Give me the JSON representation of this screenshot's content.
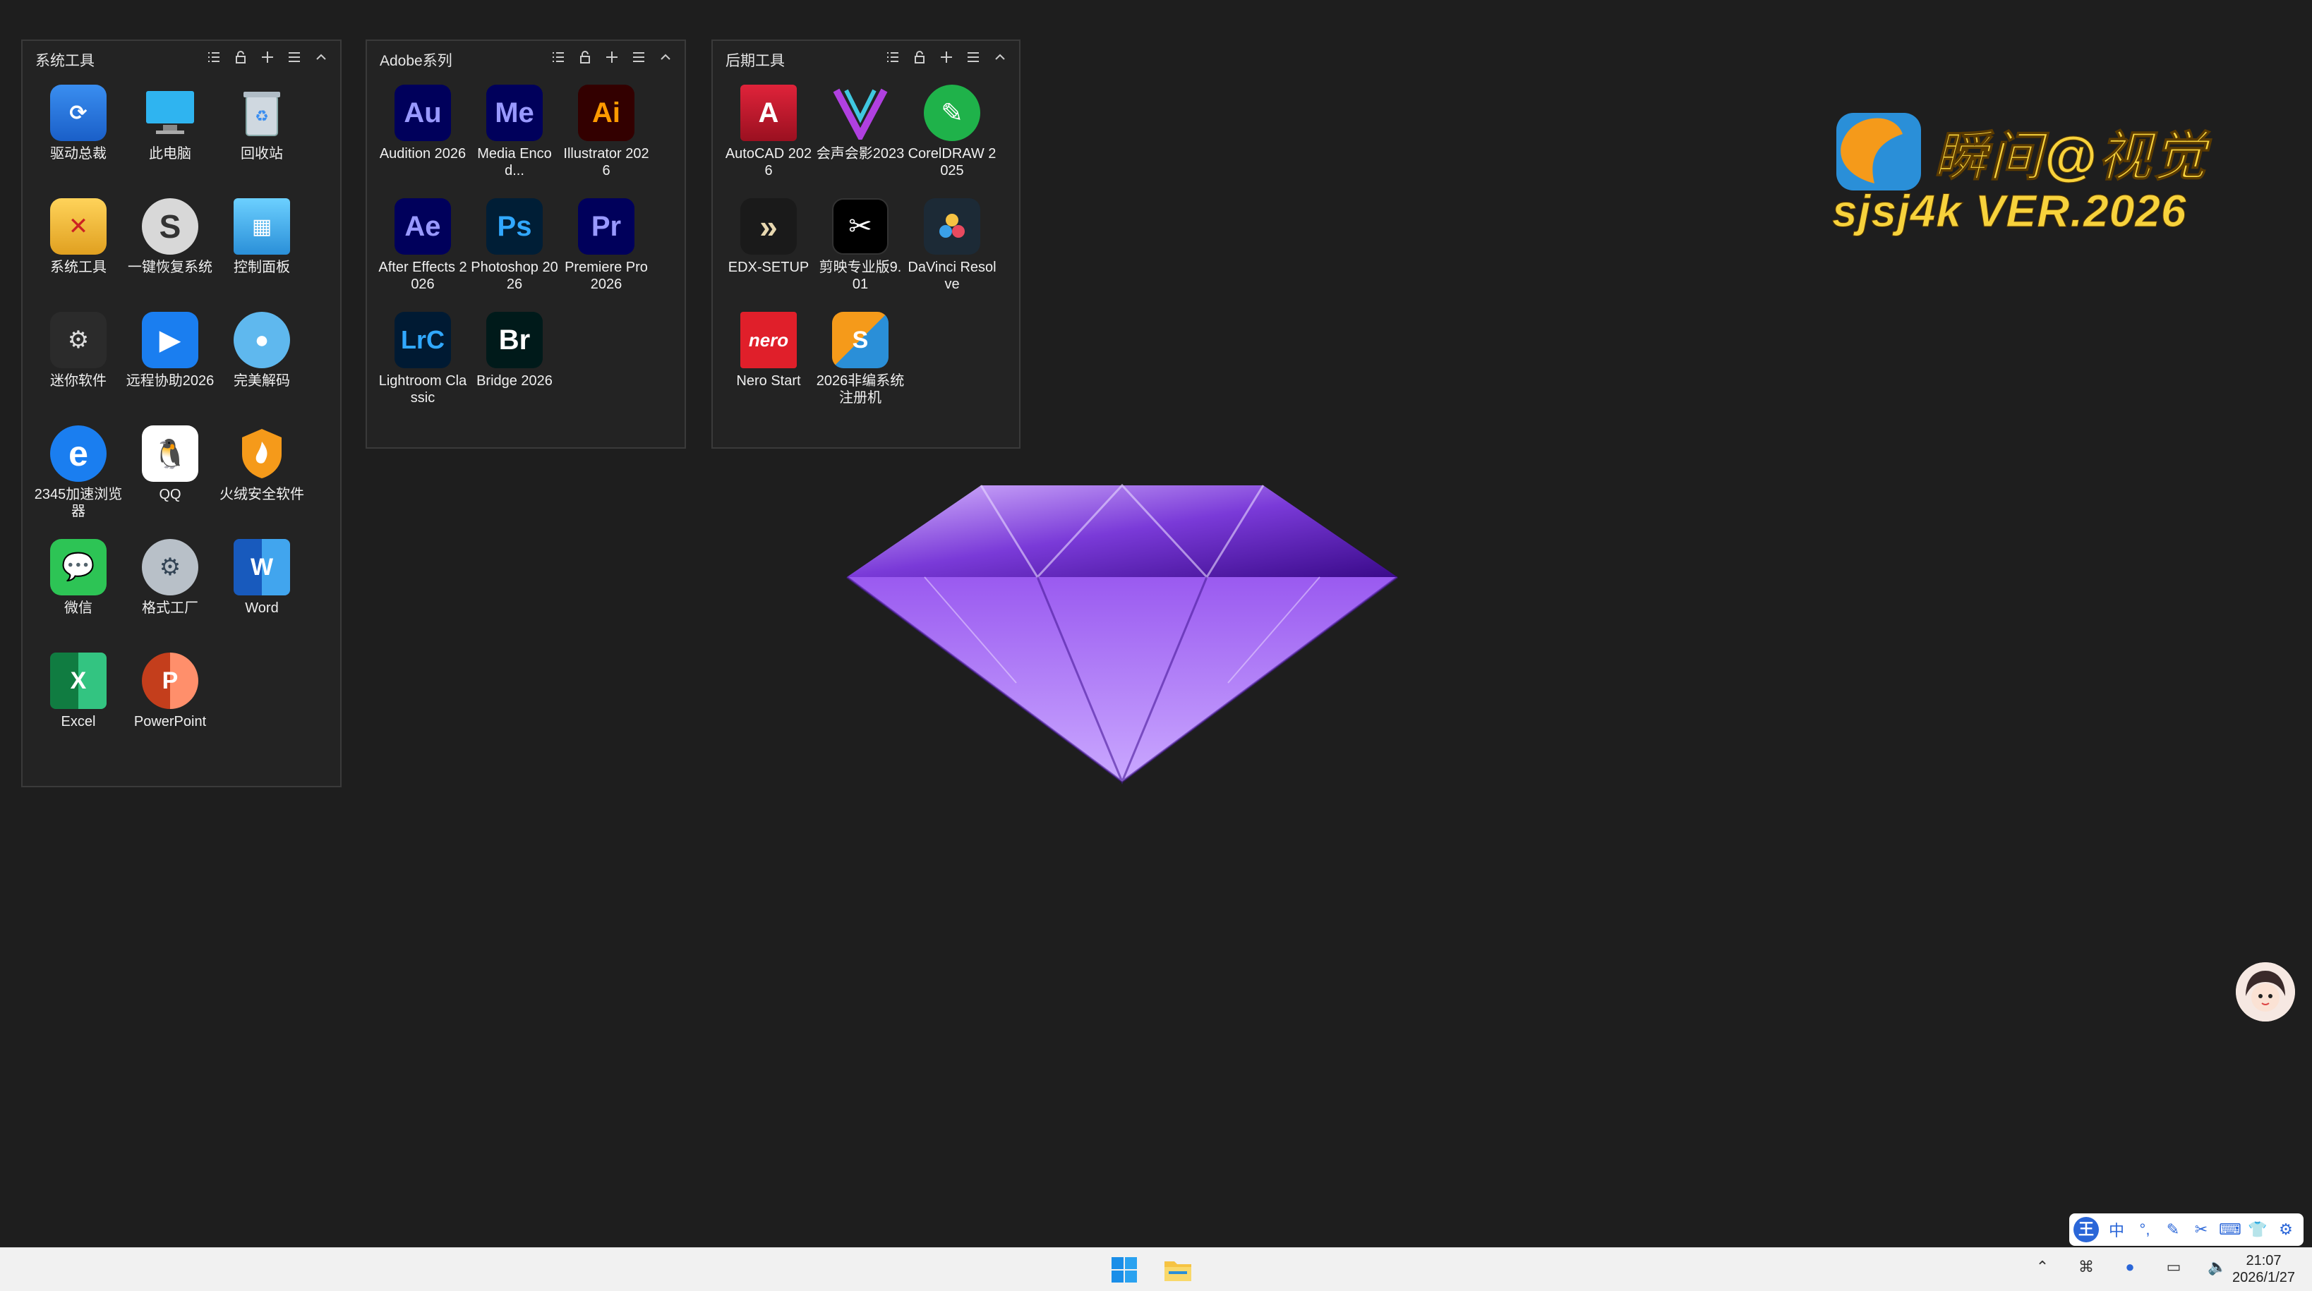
{
  "panels": [
    {
      "title": "系统工具",
      "apps": [
        {
          "label": "驱动总裁",
          "icon": "driver-tool-icon"
        },
        {
          "label": "此电脑",
          "icon": "computer-icon"
        },
        {
          "label": "回收站",
          "icon": "recycle-bin-icon"
        },
        {
          "label": "系统工具",
          "icon": "system-tools-icon"
        },
        {
          "label": "一键恢复系统",
          "icon": "system-restore-icon"
        },
        {
          "label": "控制面板",
          "icon": "control-panel-icon"
        },
        {
          "label": "迷你软件",
          "icon": "mini-software-icon"
        },
        {
          "label": "远程协助2026",
          "icon": "remote-assist-icon"
        },
        {
          "label": "完美解码",
          "icon": "potplayer-icon"
        },
        {
          "label": "2345加速浏览器",
          "icon": "browser-2345-icon"
        },
        {
          "label": "QQ",
          "icon": "qq-icon"
        },
        {
          "label": "火绒安全软件",
          "icon": "huorong-icon"
        },
        {
          "label": "微信",
          "icon": "wechat-icon"
        },
        {
          "label": "格式工厂",
          "icon": "format-factory-icon"
        },
        {
          "label": "Word",
          "icon": "word-icon"
        },
        {
          "label": "Excel",
          "icon": "excel-icon"
        },
        {
          "label": "PowerPoint",
          "icon": "powerpoint-icon"
        }
      ]
    },
    {
      "title": "Adobe系列",
      "apps": [
        {
          "label": "Audition 2026",
          "icon": "audition-icon",
          "abbr": "Au"
        },
        {
          "label": "Media Encod...",
          "icon": "media-encoder-icon",
          "abbr": "Me"
        },
        {
          "label": "Illustrator 2026",
          "icon": "illustrator-icon",
          "abbr": "Ai"
        },
        {
          "label": "After Effects 2026",
          "icon": "after-effects-icon",
          "abbr": "Ae"
        },
        {
          "label": "Photoshop 2026",
          "icon": "photoshop-icon",
          "abbr": "Ps"
        },
        {
          "label": "Premiere Pro 2026",
          "icon": "premiere-icon",
          "abbr": "Pr"
        },
        {
          "label": "Lightroom Classic",
          "icon": "lightroom-icon",
          "abbr": "LrC"
        },
        {
          "label": "Bridge 2026",
          "icon": "bridge-icon",
          "abbr": "Br"
        }
      ]
    },
    {
      "title": "后期工具",
      "apps": [
        {
          "label": "AutoCAD 2026",
          "icon": "autocad-icon"
        },
        {
          "label": "会声会影2023",
          "icon": "videostudio-icon"
        },
        {
          "label": "CorelDRAW 2025",
          "icon": "coreldraw-icon"
        },
        {
          "label": "EDX-SETUP",
          "icon": "edx-setup-icon"
        },
        {
          "label": "剪映专业版9.01",
          "icon": "capcut-icon"
        },
        {
          "label": "DaVinci Resolve",
          "icon": "davinci-icon"
        },
        {
          "label": "Nero Start",
          "icon": "nero-icon"
        },
        {
          "label": "2026非编系统注册机",
          "icon": "keygen-icon"
        }
      ]
    }
  ],
  "watermark": {
    "line1": "瞬间@视觉",
    "line2": "sjsj4k VER.2026"
  },
  "ime": {
    "items": [
      "王",
      "中",
      "°,",
      "✎",
      "✂",
      "⌨",
      "👕",
      "⚙"
    ]
  },
  "clock": {
    "time": "21:07",
    "date": "2026/1/27"
  },
  "colors": {
    "desktop": "#1e1e1e",
    "panel": "#232323",
    "accent": "#2a66d8"
  }
}
